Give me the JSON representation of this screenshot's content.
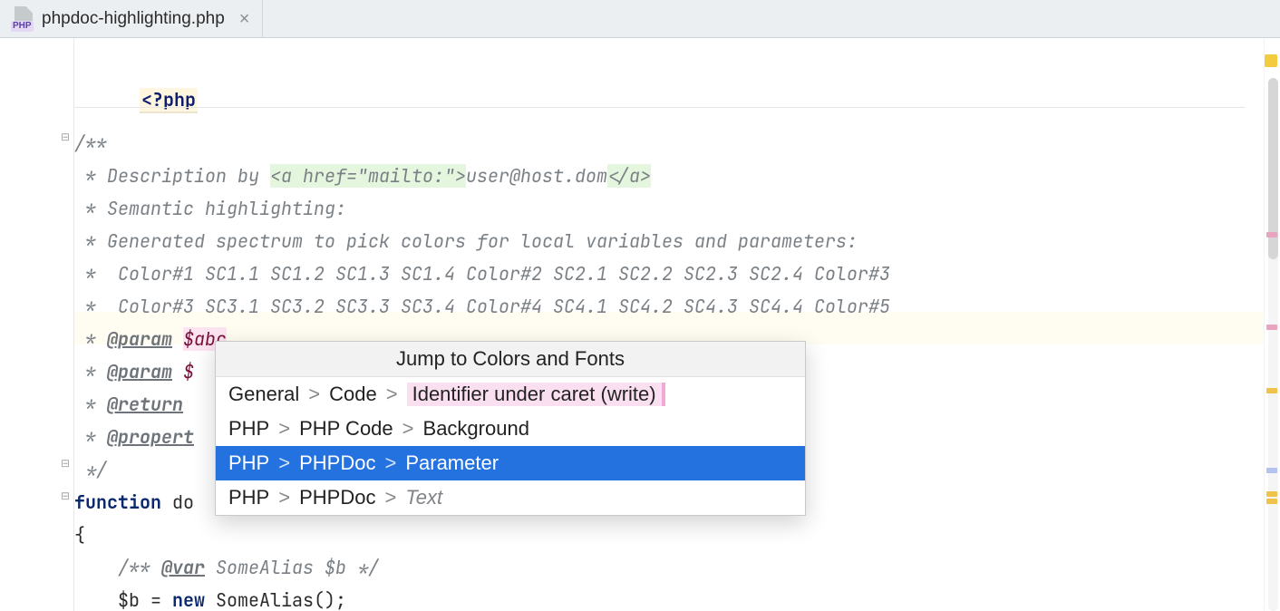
{
  "tab": {
    "file_type_label": "PHP",
    "filename": "phpdoc-highlighting.php"
  },
  "code": {
    "php_open": "<?php",
    "doc_open": "/**",
    "doc_l1_prefix": " * Description by ",
    "doc_l1_tag_open": "<a href=\"mailto:\">",
    "doc_l1_text": "user@host.dom",
    "doc_l1_tag_close": "</a>",
    "doc_l2": " * Semantic highlighting:",
    "doc_l3": " * Generated spectrum to pick colors for local variables and parameters:",
    "doc_l4": " *  Color#1 SC1.1 SC1.2 SC1.3 SC1.4 Color#2 SC2.1 SC2.2 SC2.3 SC2.4 Color#3",
    "doc_l5": " *  Color#3 SC3.1 SC3.2 SC3.3 SC3.4 Color#4 SC4.1 SC4.2 SC4.3 SC4.4 Color#5",
    "doc_param_prefix": " * ",
    "doc_param_tag": "@param",
    "doc_param_var1": "$abc",
    "doc_param_var2": "$",
    "doc_return_tag": "@return",
    "doc_property_tag": "@propert",
    "doc_close": " */",
    "fn_kw": "function",
    "fn_name": "do",
    "brace_open": "{",
    "inner_doc_prefix": "    /** ",
    "inner_doc_tag": "@var",
    "inner_doc_rest": " SomeAlias $b */",
    "assign_line": "    $b = ",
    "new_kw": "new",
    "assign_rest": " SomeAlias();"
  },
  "popup": {
    "title": "Jump to Colors and Fonts",
    "items": [
      {
        "path": [
          "General",
          "Code"
        ],
        "leaf": "Identifier under caret (write)",
        "highlight": true,
        "selected": false
      },
      {
        "path": [
          "PHP",
          "PHP Code"
        ],
        "leaf": "Background",
        "highlight": false,
        "selected": false
      },
      {
        "path": [
          "PHP",
          "PHPDoc"
        ],
        "leaf": "Parameter",
        "highlight": false,
        "selected": true
      },
      {
        "path": [
          "PHP",
          "PHPDoc"
        ],
        "leaf": "Text",
        "highlight": false,
        "selected": false,
        "disabled": true
      }
    ],
    "separator": ">"
  }
}
